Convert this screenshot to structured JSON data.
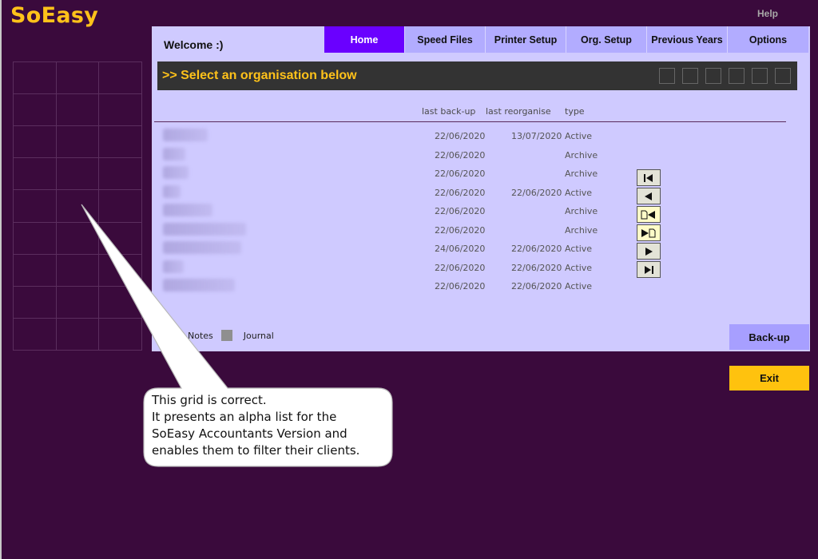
{
  "app": {
    "title": "SoEasy",
    "help": "Help"
  },
  "header": {
    "welcome": "Welcome :)"
  },
  "tabs": [
    {
      "label": "Home",
      "active": true
    },
    {
      "label": "Speed Files",
      "active": false
    },
    {
      "label": "Printer Setup",
      "active": false
    },
    {
      "label": "Org. Setup",
      "active": false
    },
    {
      "label": "Previous Years",
      "active": false
    },
    {
      "label": "Options",
      "active": false
    }
  ],
  "select_bar": {
    "text": ">> Select an organisation below"
  },
  "columns": {
    "backup": "last back-up",
    "reorganise": "last reorganise",
    "type": "type"
  },
  "organisations": [
    {
      "backup": "22/06/2020",
      "reorganise": "13/07/2020",
      "type": "Active"
    },
    {
      "backup": "22/06/2020",
      "reorganise": "",
      "type": "Archive"
    },
    {
      "backup": "22/06/2020",
      "reorganise": "",
      "type": "Archive"
    },
    {
      "backup": "22/06/2020",
      "reorganise": "22/06/2020",
      "type": "Active"
    },
    {
      "backup": "22/06/2020",
      "reorganise": "",
      "type": "Archive"
    },
    {
      "backup": "22/06/2020",
      "reorganise": "",
      "type": "Archive"
    },
    {
      "backup": "24/06/2020",
      "reorganise": "22/06/2020",
      "type": "Active"
    },
    {
      "backup": "22/06/2020",
      "reorganise": "22/06/2020",
      "type": "Active"
    },
    {
      "backup": "22/06/2020",
      "reorganise": "22/06/2020",
      "type": "Active"
    }
  ],
  "nav_icons": [
    "first-record-icon",
    "previous-record-icon",
    "insert-before-icon",
    "insert-after-icon",
    "next-record-icon",
    "last-record-icon"
  ],
  "legend": {
    "notes": "Notes",
    "journal": "Journal"
  },
  "buttons": {
    "backup": "Back-up",
    "exit": "Exit"
  },
  "callout": {
    "lines": [
      "This grid is correct.",
      "It presents an alpha list for the",
      "SoEasy Accountants Version and",
      "enables them to filter their clients."
    ]
  },
  "colors": {
    "background": "#3a0a3c",
    "brand": "#ffc21a",
    "panel": "#cfcaff",
    "tab": "#b2acff",
    "tab_active": "#6a00ff",
    "bar": "#333333",
    "exit": "#ffc20e"
  }
}
